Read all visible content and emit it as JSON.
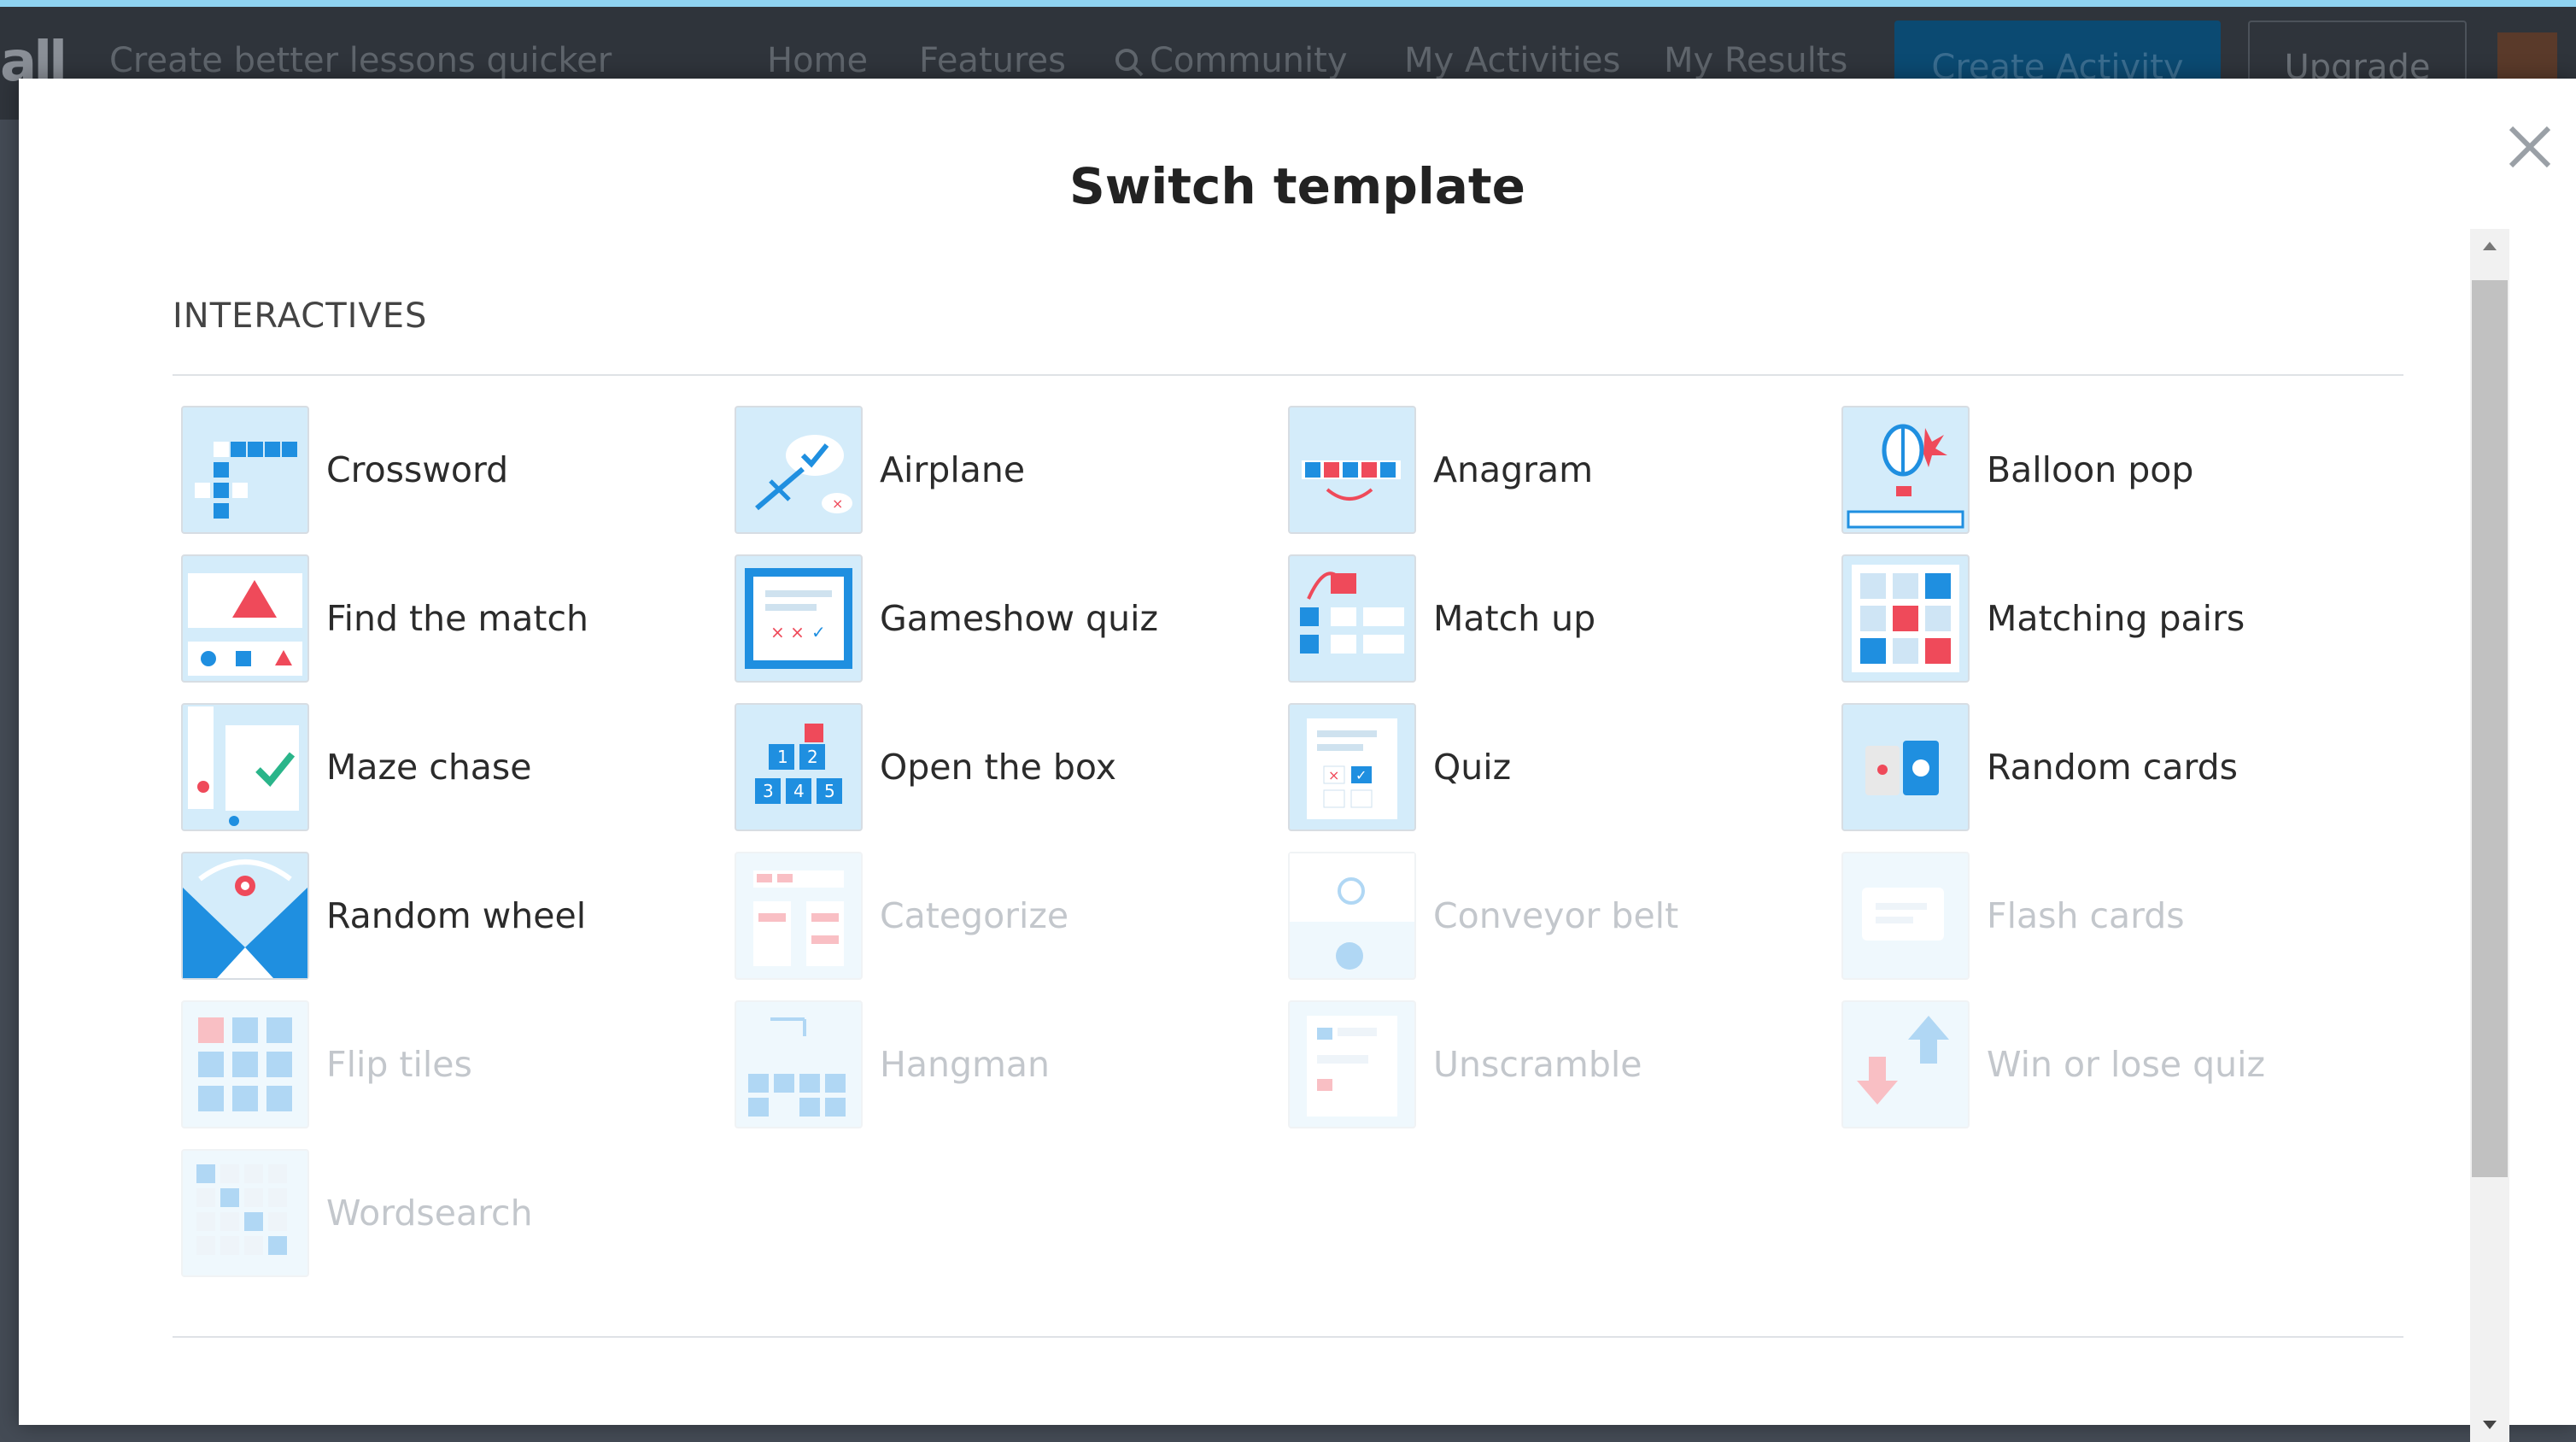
{
  "background": {
    "logo_fragment": "all",
    "tagline": "Create better lessons quicker",
    "nav": [
      "Home",
      "Features",
      "Community",
      "My Activities",
      "My Results"
    ],
    "create_button": "Create Activity",
    "upgrade_button": "Upgrade"
  },
  "modal": {
    "title": "Switch template",
    "close_icon": "close-icon",
    "section_heading": "INTERACTIVES",
    "templates": [
      {
        "label": "Crossword",
        "icon": "crossword",
        "enabled": true
      },
      {
        "label": "Airplane",
        "icon": "airplane",
        "enabled": true
      },
      {
        "label": "Anagram",
        "icon": "anagram",
        "enabled": true
      },
      {
        "label": "Balloon pop",
        "icon": "balloon",
        "enabled": true
      },
      {
        "label": "Find the match",
        "icon": "findmatch",
        "enabled": true
      },
      {
        "label": "Gameshow quiz",
        "icon": "gameshow",
        "enabled": true
      },
      {
        "label": "Match up",
        "icon": "matchup",
        "enabled": true
      },
      {
        "label": "Matching pairs",
        "icon": "pairs",
        "enabled": true
      },
      {
        "label": "Maze chase",
        "icon": "maze",
        "enabled": true
      },
      {
        "label": "Open the box",
        "icon": "openbox",
        "enabled": true
      },
      {
        "label": "Quiz",
        "icon": "quiz",
        "enabled": true
      },
      {
        "label": "Random cards",
        "icon": "cards",
        "enabled": true
      },
      {
        "label": "Random wheel",
        "icon": "wheel",
        "enabled": true
      },
      {
        "label": "Categorize",
        "icon": "categorize",
        "enabled": false
      },
      {
        "label": "Conveyor belt",
        "icon": "conveyor",
        "enabled": false
      },
      {
        "label": "Flash cards",
        "icon": "flash",
        "enabled": false
      },
      {
        "label": "Flip tiles",
        "icon": "flip",
        "enabled": false
      },
      {
        "label": "Hangman",
        "icon": "hangman",
        "enabled": false
      },
      {
        "label": "Unscramble",
        "icon": "unscramble",
        "enabled": false
      },
      {
        "label": "Win or lose quiz",
        "icon": "winlose",
        "enabled": false
      },
      {
        "label": "Wordsearch",
        "icon": "wordsearch",
        "enabled": false
      }
    ]
  },
  "colors": {
    "accent_blue": "#1f8fe0",
    "accent_red": "#ef4a5a",
    "thumb_bg": "#d4ecfa"
  }
}
